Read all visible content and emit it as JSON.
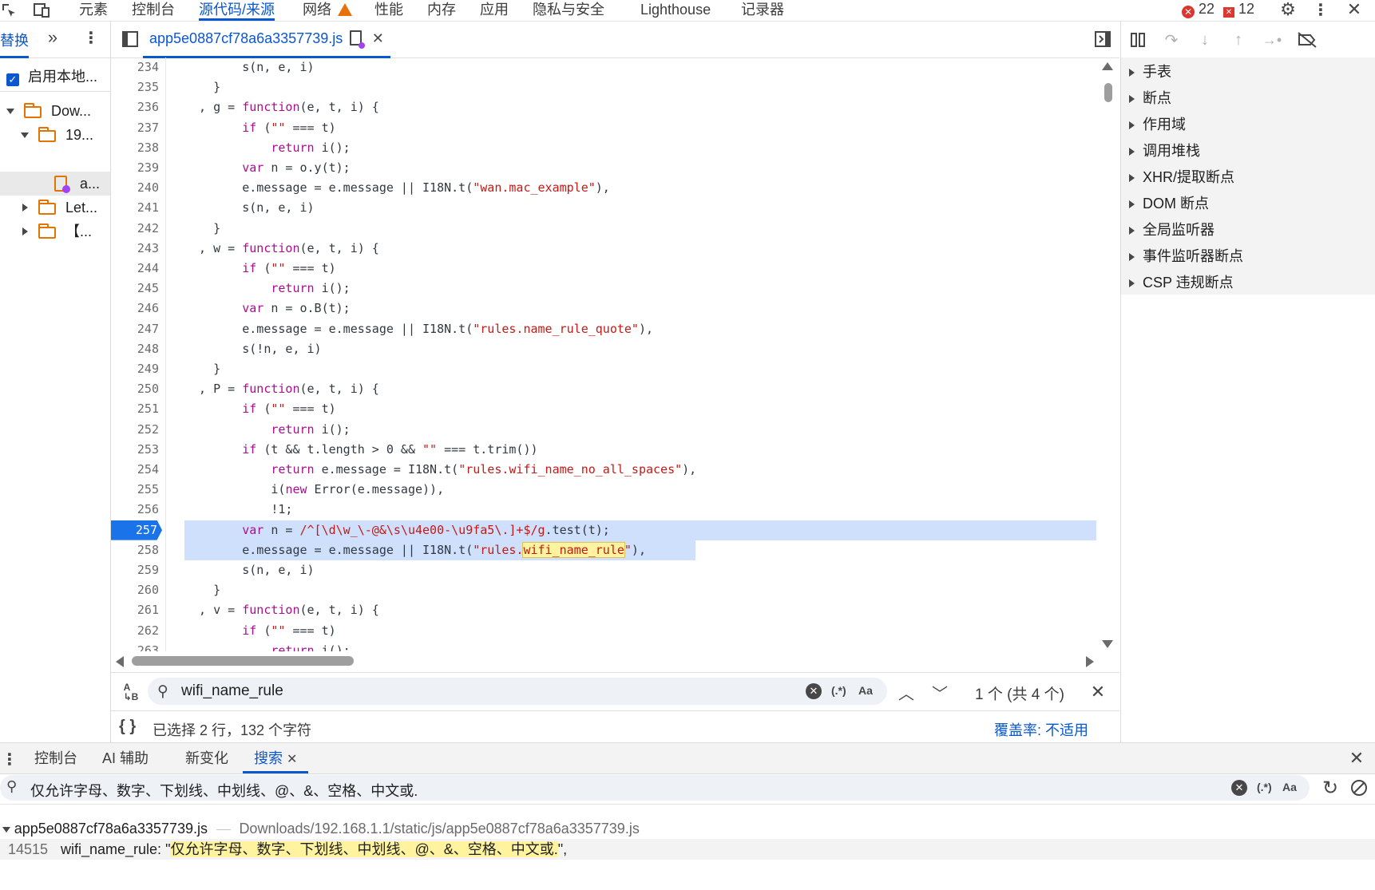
{
  "topbar": {
    "tabs": [
      "元素",
      "控制台",
      "源代码/来源",
      "网络",
      "性能",
      "内存",
      "应用",
      "隐私与安全",
      "Lighthouse",
      "记录器"
    ],
    "active_tab": "源代码/来源",
    "errors_count": "22",
    "warnings_count": "12"
  },
  "navigator": {
    "tab_label": "替换",
    "enable_local_label": "启用本地...",
    "tree": [
      {
        "label": "Dow...",
        "indent": 0,
        "expanded": true
      },
      {
        "label": "19...",
        "indent": 1,
        "expanded": true
      },
      {
        "label": "a...",
        "indent": 2,
        "file": true
      },
      {
        "label": "Let...",
        "indent": 1,
        "expanded": false
      },
      {
        "label": "【...",
        "indent": 1,
        "expanded": false
      }
    ]
  },
  "editor": {
    "file_tab": "app5e0887cf78a6a3357739.js",
    "lines": [
      {
        "n": "234",
        "html": "        s(n, e, i)"
      },
      {
        "n": "235",
        "html": "    }"
      },
      {
        "n": "236",
        "html": "  , g = <span class='kw'>function</span>(e, t, i) {"
      },
      {
        "n": "237",
        "html": "        <span class='kw'>if</span> (<span class='str'>\"\"</span> === t)"
      },
      {
        "n": "238",
        "html": "            <span class='kw'>return</span> i();"
      },
      {
        "n": "239",
        "html": "        <span class='kw'>var</span> n = o.y(t);"
      },
      {
        "n": "240",
        "html": "        e.message = e.message || I18N.t(<span class='str'>\"wan.mac_example\"</span>),"
      },
      {
        "n": "241",
        "html": "        s(n, e, i)"
      },
      {
        "n": "242",
        "html": "    }"
      },
      {
        "n": "243",
        "html": "  , w = <span class='kw'>function</span>(e, t, i) {"
      },
      {
        "n": "244",
        "html": "        <span class='kw'>if</span> (<span class='str'>\"\"</span> === t)"
      },
      {
        "n": "245",
        "html": "            <span class='kw'>return</span> i();"
      },
      {
        "n": "246",
        "html": "        <span class='kw'>var</span> n = o.B(t);"
      },
      {
        "n": "247",
        "html": "        e.message = e.message || I18N.t(<span class='str'>\"rules.name_rule_quote\"</span>),"
      },
      {
        "n": "248",
        "html": "        s(!n, e, i)"
      },
      {
        "n": "249",
        "html": "    }"
      },
      {
        "n": "250",
        "html": "  , P = <span class='kw'>function</span>(e, t, i) {"
      },
      {
        "n": "251",
        "html": "        <span class='kw'>if</span> (<span class='str'>\"\"</span> === t)"
      },
      {
        "n": "252",
        "html": "            <span class='kw'>return</span> i();"
      },
      {
        "n": "253",
        "html": "        <span class='kw'>if</span> (t && t.length > 0 && <span class='str'>\"\"</span> === t.trim())"
      },
      {
        "n": "254",
        "html": "            <span class='kw'>return</span> e.message = I18N.t(<span class='str'>\"rules.wifi_name_no_all_spaces\"</span>),"
      },
      {
        "n": "255",
        "html": "            i(<span class='kw'>new</span> Error(e.message)),"
      },
      {
        "n": "256",
        "html": "            !1;"
      },
      {
        "n": "257",
        "html": "        <span class='kw'>var</span> n = <span class='str'>/^[\\d\\w_\\-@&\\s\\u4e00-\\u9fa5\\.]+$/g</span>.test(t);",
        "sel": true,
        "bp": true
      },
      {
        "n": "258",
        "html": "        e.message = e.message || I18N.t(<span class='str'>\"rules.<span class='hi'>wifi_name_rule</span>\"</span>),",
        "sel": true
      },
      {
        "n": "259",
        "html": "        s(n, e, i)"
      },
      {
        "n": "260",
        "html": "    }"
      },
      {
        "n": "261",
        "html": "  , v = <span class='kw'>function</span>(e, t, i) {"
      },
      {
        "n": "262",
        "html": "        <span class='kw'>if</span> (<span class='str'>\"\"</span> === t)"
      },
      {
        "n": "263",
        "html": "            <span class='kw'>return</span> i();"
      }
    ],
    "find_value": "wifi_name_rule",
    "regex_label": "(.*)",
    "case_label": "Aa",
    "match_status": "1 个 (共 4 个)",
    "status_text": "已选择 2 行，132 个字符",
    "coverage_label": "覆盖率:",
    "coverage_value": "不适用"
  },
  "debugger": {
    "sections": [
      "手表",
      "断点",
      "作用域",
      "调用堆栈",
      "XHR/提取断点",
      "DOM 断点",
      "全局监听器",
      "事件监听器断点",
      "CSP 违规断点"
    ]
  },
  "drawer": {
    "tabs": [
      "控制台",
      "AI 辅助",
      "新变化",
      "搜索"
    ],
    "active_tab": "搜索",
    "search_value": "仅允许字母、数字、下划线、中划线、@、&、空格、中文或.",
    "regex_label": "(.*)",
    "case_label": "Aa",
    "result_file": "app5e0887cf78a6a3357739.js",
    "result_path": "Downloads/192.168.1.1/static/js/app5e0887cf78a6a3357739.js",
    "result_line": "14515",
    "result_prefix": "wifi_name_rule: \"",
    "result_match": "仅允许字母、数字、下划线、中划线、@、&、空格、中文或.",
    "result_suffix": "\","
  }
}
